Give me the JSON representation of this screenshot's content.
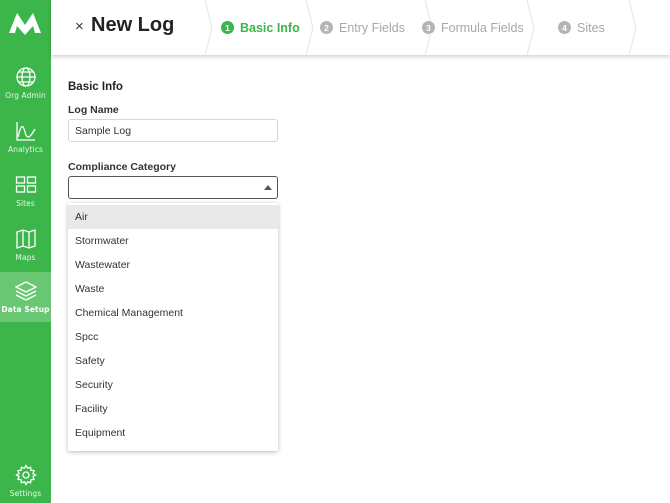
{
  "sidebar": {
    "accent_color": "#3cb54a",
    "active_color": "#69c774",
    "items": [
      {
        "label": "Org Admin",
        "icon": "globe-icon"
      },
      {
        "label": "Analytics",
        "icon": "chart-line-icon"
      },
      {
        "label": "Sites",
        "icon": "grid-icon"
      },
      {
        "label": "Maps",
        "icon": "map-icon"
      },
      {
        "label": "Data Setup",
        "icon": "layers-icon",
        "active": true
      },
      {
        "label": "Settings",
        "icon": "gear-icon"
      }
    ]
  },
  "header": {
    "close": "×",
    "title": "New Log",
    "steps": [
      {
        "num": "1",
        "label": "Basic Info",
        "active": true
      },
      {
        "num": "2",
        "label": "Entry Fields"
      },
      {
        "num": "3",
        "label": "Formula Fields"
      },
      {
        "num": "4",
        "label": "Sites"
      }
    ]
  },
  "form": {
    "section_title": "Basic Info",
    "log_name_label": "Log Name",
    "log_name_value": "Sample Log",
    "compliance_label": "Compliance Category",
    "compliance_value": "",
    "options": [
      "Air",
      "Stormwater",
      "Wastewater",
      "Waste",
      "Chemical Management",
      "Spcc",
      "Safety",
      "Security",
      "Facility",
      "Equipment"
    ],
    "highlighted_option": "Air"
  }
}
